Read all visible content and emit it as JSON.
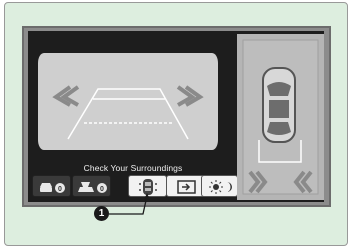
{
  "colors": {
    "panel_background": "#ddeedf",
    "screen": "#1d1d1d",
    "guideline": "#ffffff",
    "surround_top_view": "#b5b5b5"
  },
  "rear_camera": {
    "icons": [
      "left-wide-chevron-icon",
      "right-wide-chevron-icon"
    ]
  },
  "status_message": "Check Your Surroundings",
  "buttons": [
    {
      "icon": "parking-sensor-front-off-icon",
      "selected": false
    },
    {
      "icon": "parking-sensor-rear-off-icon",
      "selected": false
    },
    {
      "icon": "top-view-car-icon",
      "selected": true
    },
    {
      "icon": "camera-view-switch-icon",
      "selected": false
    },
    {
      "icon": "brightness-icon",
      "selected": false
    }
  ],
  "callout": "1"
}
